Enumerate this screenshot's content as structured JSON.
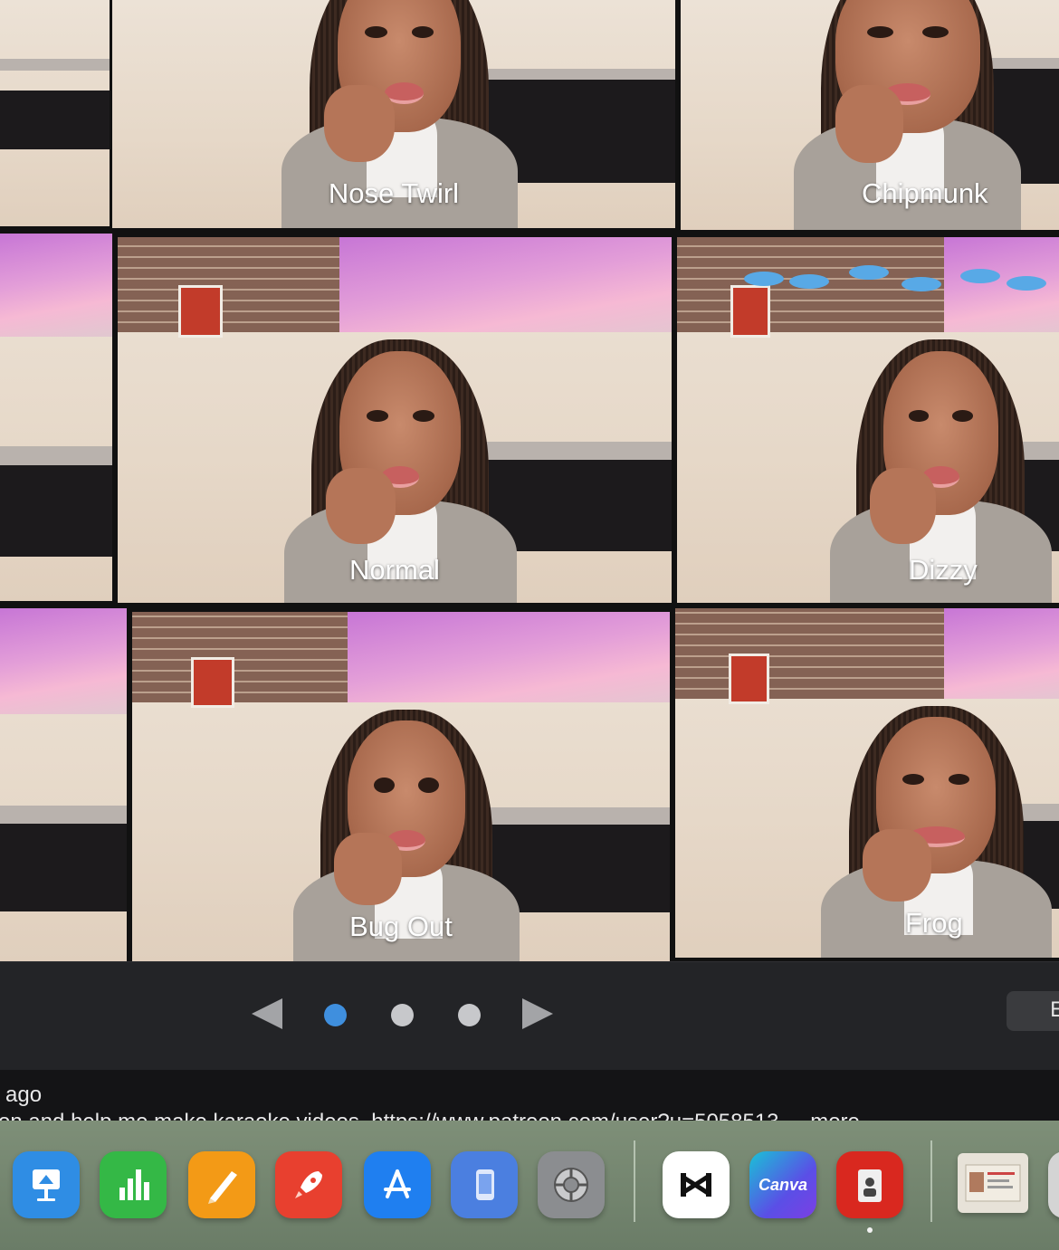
{
  "effects": [
    {
      "name": "Nose Twirl"
    },
    {
      "name": "Chipmunk"
    },
    {
      "name": "Normal"
    },
    {
      "name": "Dizzy"
    },
    {
      "name": "Bug Out"
    },
    {
      "name": "Frog"
    }
  ],
  "carousel": {
    "pages": 3,
    "active_page": 1,
    "side_button_label": "E"
  },
  "description": {
    "time_ago": "ago",
    "text": "on and help me make karaoke videos. https://www.patreon.com/user?u=5058513",
    "more": "more"
  },
  "dock": {
    "apps": [
      {
        "name": "Keynote",
        "icon": "keynote-icon",
        "color": "#2f8de4"
      },
      {
        "name": "Numbers",
        "icon": "numbers-icon",
        "color": "#34b846"
      },
      {
        "name": "Pages",
        "icon": "pages-icon",
        "color": "#f39a16"
      },
      {
        "name": "Rocket Typist",
        "icon": "rocket-icon",
        "color": "#e8402f"
      },
      {
        "name": "App Store",
        "icon": "app-store-icon",
        "color": "#1f7ff0"
      },
      {
        "name": "Simulator",
        "icon": "simulator-icon",
        "color": "#4b7fe0"
      },
      {
        "name": "System Settings",
        "icon": "gear-icon",
        "color": "#8b8d90"
      },
      {
        "name": "CapCut",
        "icon": "capcut-icon",
        "color": "#ffffff"
      },
      {
        "name": "Canva",
        "icon": "canva-icon",
        "color": "#5a4fe6",
        "text": "Canva"
      },
      {
        "name": "Photo Booth",
        "icon": "photo-booth-icon",
        "color": "#d9281f"
      },
      {
        "name": "Driver License",
        "icon": "id-card-icon",
        "color": "#e7e2d8"
      }
    ]
  }
}
